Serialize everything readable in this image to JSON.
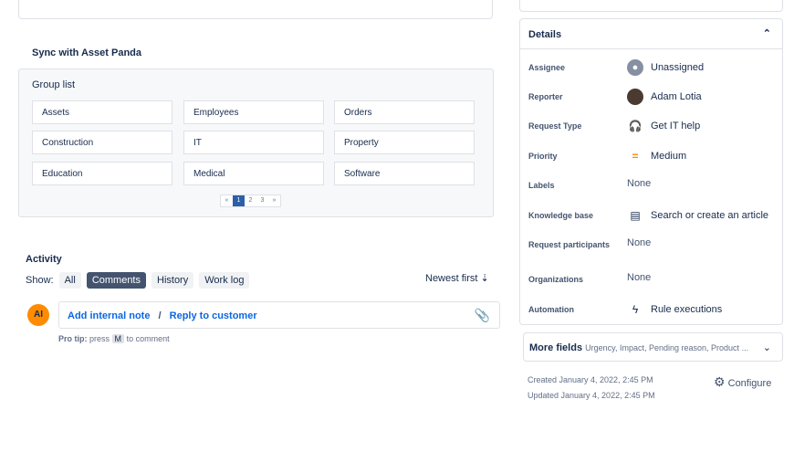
{
  "sync": {
    "title": "Sync with Asset Panda",
    "group_label": "Group list",
    "groups": [
      "Assets",
      "Employees",
      "Orders",
      "Construction",
      "IT",
      "Property",
      "Education",
      "Medical",
      "Software"
    ],
    "pager": [
      "«",
      "1",
      "2",
      "3",
      "»"
    ]
  },
  "activity": {
    "title": "Activity",
    "show_label": "Show:",
    "filters": [
      "All",
      "Comments",
      "History",
      "Work log"
    ],
    "sort": "Newest first ⇣",
    "avatar": "AI",
    "add_note": "Add internal note",
    "sep": "/",
    "reply": "Reply to customer",
    "protip_label": "Pro tip:",
    "protip_pre": "press",
    "protip_key": "M",
    "protip_post": "to comment"
  },
  "details": {
    "title": "Details",
    "rows": [
      {
        "label": "Assignee",
        "value": "Unassigned"
      },
      {
        "label": "Reporter",
        "value": "Adam Lotia"
      },
      {
        "label": "Request Type",
        "value": "Get IT help"
      },
      {
        "label": "Priority",
        "value": "Medium"
      },
      {
        "label": "Labels",
        "value": "None"
      },
      {
        "label": "Knowledge base",
        "value": "Search or create an article"
      },
      {
        "label": "Request participants",
        "value": "None"
      },
      {
        "label": "Organizations",
        "value": "None"
      },
      {
        "label": "Automation",
        "value": "Rule executions"
      }
    ]
  },
  "more_fields": {
    "label": "More fields",
    "summary": "Urgency, Impact, Pending reason, Product ..."
  },
  "meta": {
    "created": "Created January 4, 2022, 2:45 PM",
    "updated": "Updated January 4, 2022, 2:45 PM",
    "configure": "Configure"
  },
  "colors": {
    "accent": "#0c66e4",
    "selected": "#44546f",
    "avatar": "#ff8b00"
  }
}
